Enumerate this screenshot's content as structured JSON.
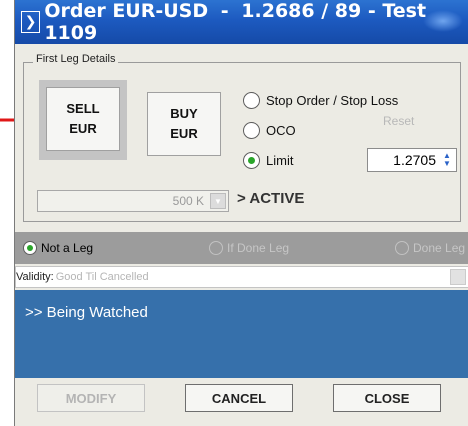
{
  "title": {
    "icon": "order-window-icon",
    "order_label": "Order EUR-USD",
    "separator": "-",
    "price": "1.2686 / 89",
    "account": "- Test 1109"
  },
  "first_leg": {
    "legend": "First Leg Details",
    "sell": {
      "line1": "SELL",
      "line2": "EUR"
    },
    "buy": {
      "line1": "BUY",
      "line2": "EUR"
    },
    "order_types": [
      {
        "label": "Stop Order / Stop Loss",
        "selected": false
      },
      {
        "label": "OCO",
        "selected": false
      },
      {
        "label": "Limit",
        "selected": true
      }
    ],
    "reset_label": "Reset",
    "limit_price": "1.2705",
    "quantity": "500 K",
    "status_active": "> ACTIVE"
  },
  "legs": [
    {
      "label": "Not a Leg",
      "selected": true,
      "enabled": true
    },
    {
      "label": "If Done Leg",
      "selected": false,
      "enabled": false
    },
    {
      "label": "Done Leg",
      "selected": false,
      "enabled": false
    }
  ],
  "validity": {
    "label": "Validity:",
    "value": "Good Til Cancelled"
  },
  "status_text": ">> Being Watched",
  "buttons": {
    "modify": "MODIFY",
    "cancel": "CANCEL",
    "close": "CLOSE"
  },
  "colors": {
    "title_bar": "#1d5ac0",
    "status_panel": "#3670ab",
    "pointer_arrow": "#e01818"
  }
}
